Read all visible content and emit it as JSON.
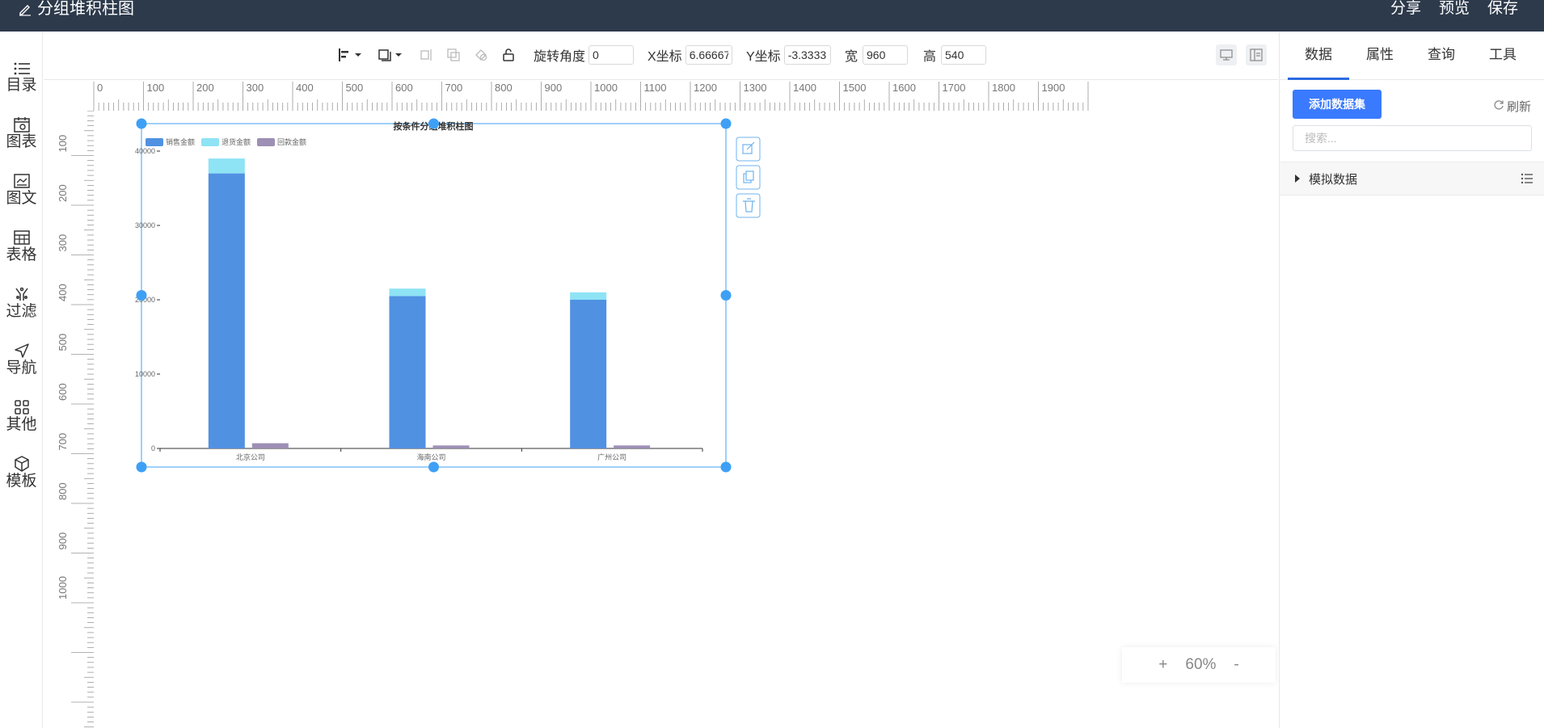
{
  "header": {
    "title": "分组堆积柱图",
    "actions": [
      "分享",
      "预览",
      "保存"
    ]
  },
  "leftnav": {
    "items": [
      {
        "label": "目录",
        "icon": "list-icon"
      },
      {
        "label": "图表",
        "icon": "chart-calendar-icon"
      },
      {
        "label": "图文",
        "icon": "image-text-icon"
      },
      {
        "label": "表格",
        "icon": "table-icon"
      },
      {
        "label": "过滤",
        "icon": "filter-icon"
      },
      {
        "label": "导航",
        "icon": "send-icon"
      },
      {
        "label": "其他",
        "icon": "grid-icon"
      },
      {
        "label": "模板",
        "icon": "cube-icon"
      }
    ]
  },
  "toolbar": {
    "rotate_label": "旋转角度",
    "rotate_value": "0",
    "x_label": "X坐标",
    "x_value": "6.66667",
    "y_label": "Y坐标",
    "y_value": "-3.3333",
    "w_label": "宽",
    "w_value": "960",
    "h_label": "高",
    "h_value": "540"
  },
  "ruler": {
    "h_labels": [
      "0",
      "100",
      "200",
      "300",
      "400",
      "500",
      "600",
      "700",
      "800",
      "900",
      "1000",
      "1100",
      "1200",
      "1300",
      "1400",
      "1500",
      "1600",
      "1700",
      "1800",
      "1900"
    ],
    "v_labels": [
      "100",
      "200",
      "300",
      "400",
      "500",
      "600",
      "700",
      "800",
      "900",
      "1000"
    ]
  },
  "zoom": {
    "plus": "+",
    "value": "60%",
    "minus": "-"
  },
  "rightpanel": {
    "tabs": [
      "数据",
      "属性",
      "查询",
      "工具"
    ],
    "active_tab": 0,
    "add_dataset": "添加数据集",
    "refresh": "刷新",
    "search_placeholder": "搜索...",
    "dataset_name": "模拟数据"
  },
  "colors": {
    "topbar": "#2d3a4b",
    "accent": "#3a7afe",
    "handle": "#3ea0f5",
    "series1": "#5191e2",
    "series2": "#8ee3f5",
    "series3": "#9d8fb5"
  },
  "chart_data": {
    "type": "bar",
    "title": "按条件分组堆积柱图",
    "categories": [
      "北京公司",
      "海南公司",
      "广州公司"
    ],
    "series": [
      {
        "name": "销售金额",
        "stack": "a",
        "values": [
          37000,
          20500,
          20000
        ]
      },
      {
        "name": "退货金额",
        "stack": "a",
        "values": [
          2000,
          1000,
          1000
        ]
      },
      {
        "name": "回款金额",
        "stack": "b",
        "values": [
          700,
          400,
          400
        ]
      }
    ],
    "yticks": [
      "0",
      "10000",
      "20000",
      "30000",
      "40000"
    ],
    "ylim": [
      0,
      40000
    ],
    "legend": "top-left"
  }
}
